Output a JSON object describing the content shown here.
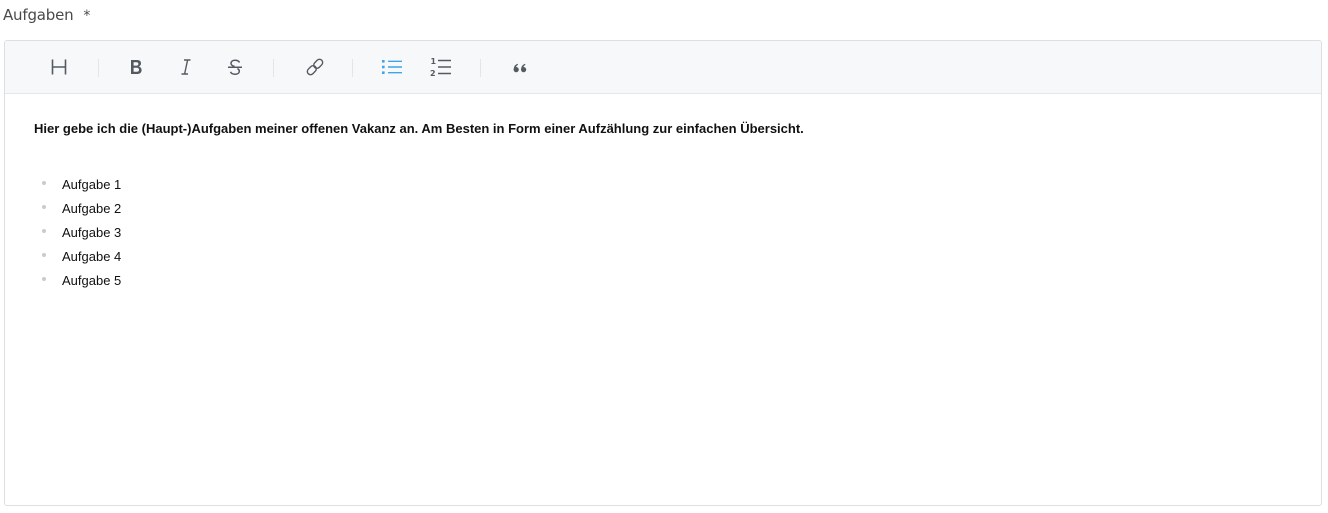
{
  "field": {
    "label": "Aufgaben",
    "required_marker": "*"
  },
  "toolbar": {
    "buttons": [
      {
        "name": "heading",
        "icon": "heading-icon",
        "active": false
      },
      {
        "name": "bold",
        "icon": "bold-icon",
        "active": false
      },
      {
        "name": "italic",
        "icon": "italic-icon",
        "active": false
      },
      {
        "name": "strikethrough",
        "icon": "strikethrough-icon",
        "active": false
      },
      {
        "name": "link",
        "icon": "link-icon",
        "active": false
      },
      {
        "name": "bullet-list",
        "icon": "bullet-list-icon",
        "active": true
      },
      {
        "name": "numbered-list",
        "icon": "numbered-list-icon",
        "active": false
      },
      {
        "name": "quote",
        "icon": "quote-icon",
        "active": false
      }
    ],
    "icon_color": "#555a61",
    "active_color": "#3fa4e8"
  },
  "content": {
    "intro": "Hier gebe ich die (Haupt-)Aufgaben meiner offenen Vakanz an. Am Besten in Form einer Aufzählung zur einfachen Übersicht.",
    "items": [
      "Aufgabe 1",
      "Aufgabe 2",
      "Aufgabe 3",
      "Aufgabe 4",
      "Aufgabe 5"
    ]
  }
}
